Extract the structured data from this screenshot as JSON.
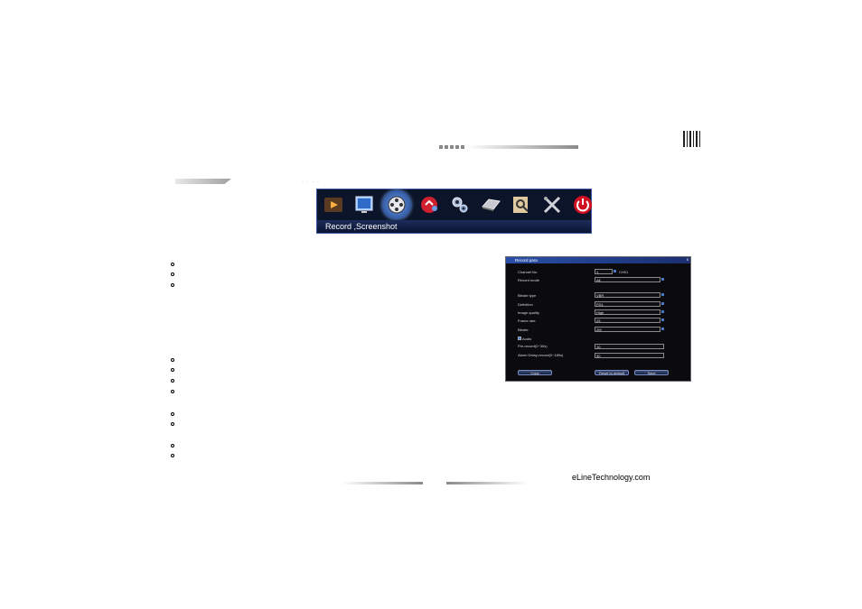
{
  "menu": {
    "label": "Record ,Screenshot",
    "icons": [
      "video-play-icon",
      "monitor-icon",
      "film-reel-icon",
      "alarm-icon",
      "system-gears-icon",
      "hard-disk-icon",
      "search-icon",
      "tools-icon",
      "power-icon"
    ]
  },
  "dialog": {
    "title": "Record para",
    "close": "x",
    "channel_label": "Channel No.",
    "channel_value": "1",
    "channel_name": "CH01",
    "record_mode_label": "Record mode",
    "record_mode_value": "All",
    "bitrate_type_label": "Bitrate type",
    "bitrate_type_value": "VBR",
    "definition_label": "Definition",
    "definition_value": "FD1",
    "image_quality_label": "Image quality",
    "image_quality_value": "High",
    "frame_rate_label": "Frame rate",
    "frame_rate_value": "25",
    "bitrate_label": "Bitrate",
    "bitrate_value": "2M",
    "audio_label": "Audio",
    "prerecord_label": "Pre-record(0~30s)",
    "prerecord_value": "10",
    "alarm_delay_label": "Alarm Delay-record(0~180s)",
    "alarm_delay_value": "30",
    "copy_button": "Copy",
    "reset_button": "Reset to default",
    "save_button": "Save"
  },
  "footer": {
    "brand": "eLineTechnology.com"
  }
}
